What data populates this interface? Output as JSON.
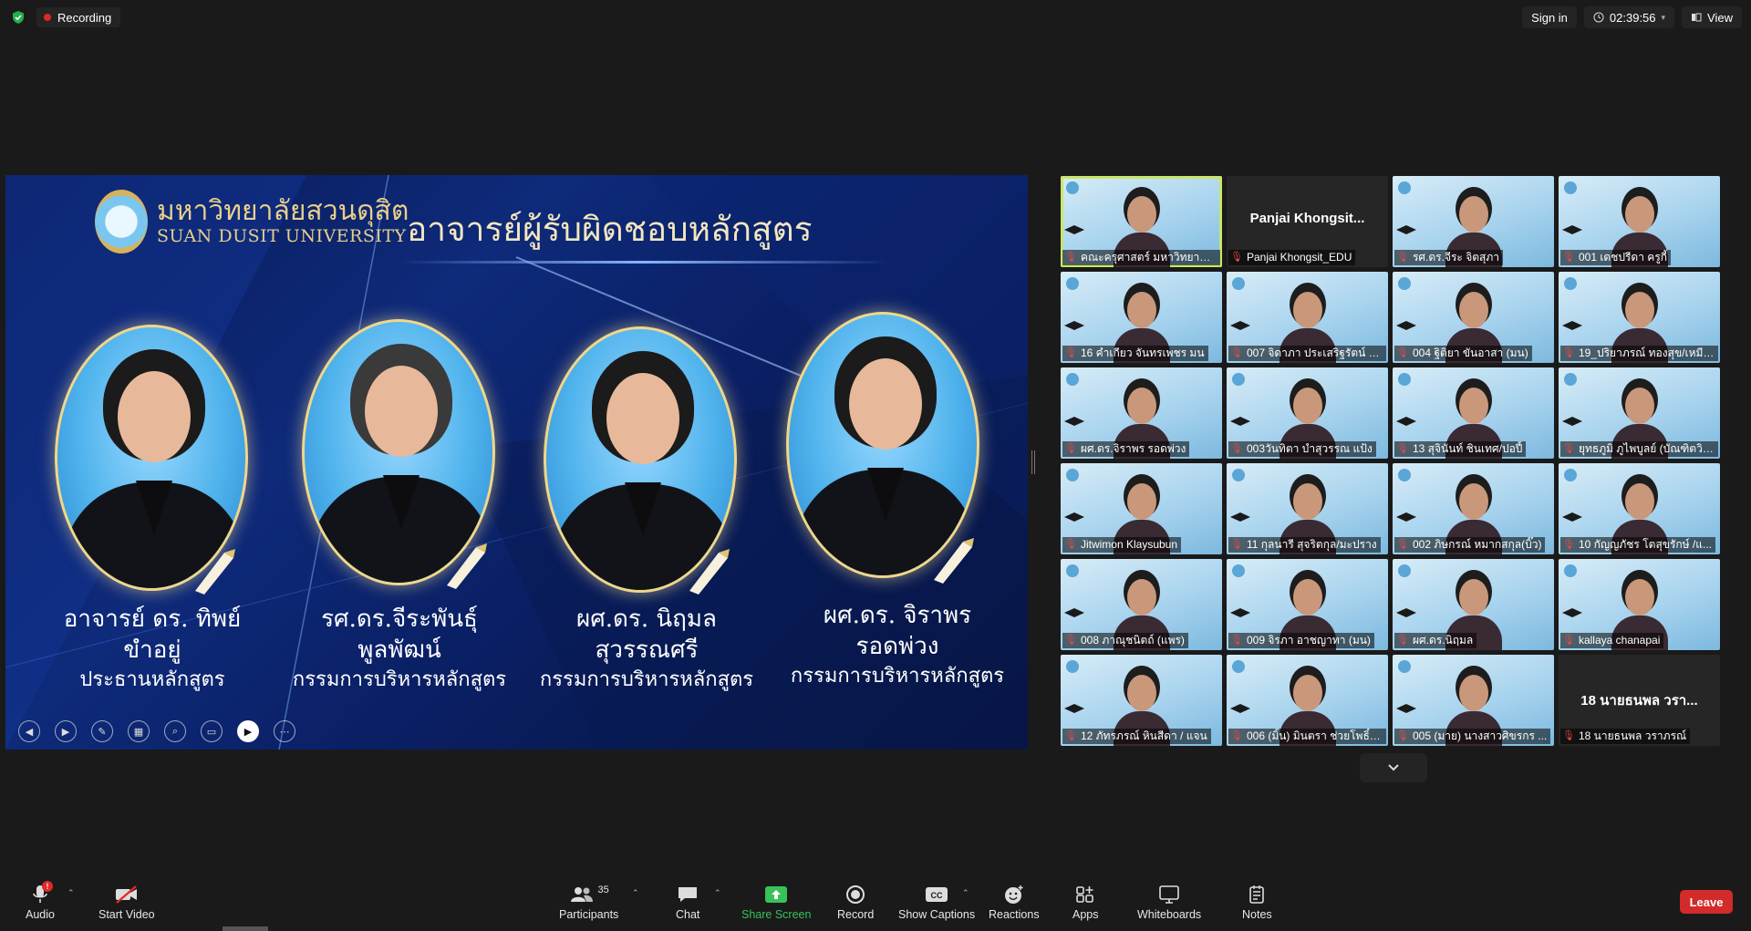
{
  "topbar": {
    "recording_label": "Recording",
    "sign_in_label": "Sign in",
    "timer": "02:39:56",
    "view_label": "View"
  },
  "slide": {
    "university_th": "มหาวิทยาลัยสวนดุสิต",
    "university_en": "SUAN DUSIT UNIVERSITY",
    "title": "อาจารย์ผู้รับผิดชอบหลักสูตร",
    "people": [
      {
        "line1": "อาจารย์ ดร. ทิพย์",
        "line2": "ขำอยู่",
        "role": "ประธานหลักสูตร"
      },
      {
        "line1": "รศ.ดร.จีระพันธุ์",
        "line2": "พูลพัฒน์",
        "role": "กรรมการบริหารหลักสูตร"
      },
      {
        "line1": "ผศ.ดร. นิฤมล",
        "line2": "สุวรรณศรี",
        "role": "กรรมการบริหารหลักสูตร"
      },
      {
        "line1": "ผศ.ดร. จิราพร",
        "line2": "รอดพ่วง",
        "role": "กรรมการบริหารหลักสูตร"
      }
    ]
  },
  "gallery": {
    "tiles": [
      {
        "name": "คณะครุศาสตร์ มหาวิทยาลัยส...",
        "center": "",
        "highlight": true
      },
      {
        "name": "Panjai Khongsit_EDU",
        "center": "Panjai  Khongsit...",
        "highlight": false
      },
      {
        "name": "รศ.ดร.จีระ จิตสุภา",
        "center": "",
        "highlight": false
      },
      {
        "name": "001 เดชปรีดา ครูกี้",
        "center": "",
        "highlight": false
      },
      {
        "name": "16 คำเกียว จันทรเพชร มน",
        "center": "",
        "highlight": false
      },
      {
        "name": "007 จิดาภา ประเสริฐรัตน์ (น...",
        "center": "",
        "highlight": false
      },
      {
        "name": "004 ฐิติยา ขันอาสา (มน)",
        "center": "",
        "highlight": false
      },
      {
        "name": "19_ปริยาภรณ์ ทองสุข/เหมียว",
        "center": "",
        "highlight": false
      },
      {
        "name": "ผศ.ดร.จิราพร รอดพ่วง",
        "center": "",
        "highlight": false
      },
      {
        "name": "003วันทิตา บำสุวรรณ แป้ง",
        "center": "",
        "highlight": false
      },
      {
        "name": "13 สุจินันท์ ชินเทศ/ปอปี้",
        "center": "",
        "highlight": false
      },
      {
        "name": "ยุทธภูมิ ภูไพบูลย์ (บัณฑิตวิท...",
        "center": "",
        "highlight": false
      },
      {
        "name": "Jitwimon Klaysubun",
        "center": "",
        "highlight": false
      },
      {
        "name": "11 กุลนารี สุจริตกุล/มะปราง",
        "center": "",
        "highlight": false
      },
      {
        "name": "002 ภิษกรณ์ หมากสกุล(บิ๊ว)",
        "center": "",
        "highlight": false
      },
      {
        "name": "10 กัญญภัชร โตสุขรักษ์ /แ...",
        "center": "",
        "highlight": false
      },
      {
        "name": "008 ภาณุชนิตถ์ (แพร)",
        "center": "",
        "highlight": false
      },
      {
        "name": "009 จิรภา อาชญาทา (มน)",
        "center": "",
        "highlight": false
      },
      {
        "name": "ผศ.ดร.นิฤมล",
        "center": "",
        "highlight": false
      },
      {
        "name": "kallaya chanapai",
        "center": "",
        "highlight": false
      },
      {
        "name": "12 ภัทรภรณ์ หินสีดา / แจน",
        "center": "",
        "highlight": false
      },
      {
        "name": "006 (มิ้น) มินตรา ช่วยโพธิ์ก...",
        "center": "",
        "highlight": false
      },
      {
        "name": "005 (มาย) นางสาวศิขรกร ...",
        "center": "",
        "highlight": false
      },
      {
        "name": "18 นายธนพล วราภรณ์",
        "center": "18 นายธนพล วรา...",
        "highlight": false
      }
    ]
  },
  "toolbar": {
    "audio": "Audio",
    "audio_badge": "!",
    "start_video": "Start Video",
    "participants": "Participants",
    "participants_count": "35",
    "chat": "Chat",
    "share_screen": "Share Screen",
    "record": "Record",
    "show_captions": "Show Captions",
    "reactions": "Reactions",
    "apps": "Apps",
    "whiteboards": "Whiteboards",
    "notes": "Notes",
    "leave": "Leave",
    "accent_green": "#38c25a",
    "leave_red": "#d32a2a"
  }
}
